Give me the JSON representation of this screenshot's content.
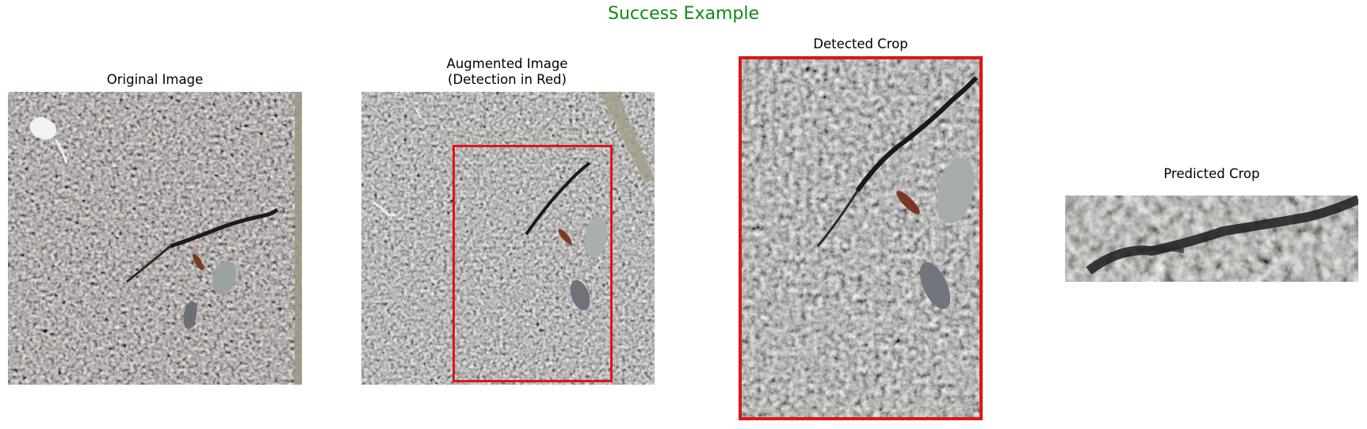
{
  "figure": {
    "suptitle": "Success Example",
    "suptitle_color": "#118a11"
  },
  "panels": [
    {
      "title": "Original Image"
    },
    {
      "title": "Augmented Image\n(Detection in Red)"
    },
    {
      "title": "Detected Crop"
    },
    {
      "title": "Predicted Crop"
    }
  ],
  "detection_box_color": "#e0141a",
  "image_subject": "cracked-asphalt-texture"
}
